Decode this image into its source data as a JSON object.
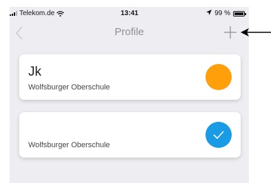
{
  "status_bar": {
    "carrier": "Telekom.de",
    "time": "13:41",
    "battery_percent": "99 %",
    "battery_level": 0.99,
    "icons": [
      "signal-icon",
      "wifi-icon",
      "location-arrow-icon",
      "battery-icon"
    ]
  },
  "nav": {
    "title": "Profile",
    "back_icon": "chevron-left-icon",
    "add_icon": "plus-icon"
  },
  "profiles": [
    {
      "name": "Jk",
      "school": "Wolfsburger Oberschule",
      "status": "inactive",
      "indicator_color": "#ff9f0a"
    },
    {
      "name": "",
      "school": "Wolfsburger Oberschule",
      "status": "selected",
      "indicator_color": "#1a9be6",
      "indicator_icon": "checkmark-icon"
    }
  ],
  "colors": {
    "background": "#eeeef2",
    "nav_gray": "#8e8e93",
    "orange": "#ff9f0a",
    "blue": "#1a9be6"
  },
  "annotation": {
    "icon": "arrow-left-icon"
  }
}
